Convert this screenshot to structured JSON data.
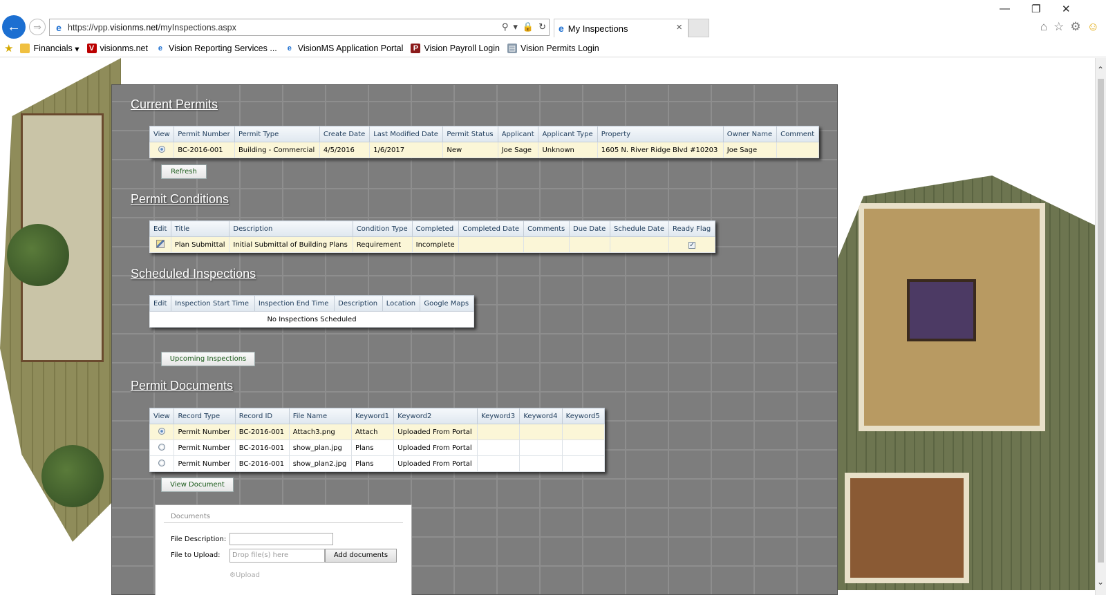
{
  "browser": {
    "url_prefix": "https://vpp.",
    "url_domain": "visionms.net",
    "url_path": "/myInspections.aspx",
    "tab_title": "My Inspections",
    "favorites": [
      {
        "label": "Financials",
        "icon": "folder-icon",
        "has_dropdown": true
      },
      {
        "label": "visionms.net",
        "icon": "vision-logo-icon"
      },
      {
        "label": "Vision Reporting Services ...",
        "icon": "ie-page-icon"
      },
      {
        "label": "VisionMS Application Portal",
        "icon": "ie-page-icon"
      },
      {
        "label": "Vision Payroll Login",
        "icon": "payroll-logo-icon"
      },
      {
        "label": "Vision Permits Login",
        "icon": "permits-page-icon"
      }
    ]
  },
  "current_permits": {
    "title": "Current Permits",
    "columns": [
      "View",
      "Permit Number",
      "Permit Type",
      "Create Date",
      "Last Modified Date",
      "Permit Status",
      "Applicant",
      "Applicant Type",
      "Property",
      "Owner Name",
      "Comment"
    ],
    "rows": [
      {
        "permit_number": "BC-2016-001",
        "permit_type": "Building - Commercial",
        "create_date": "4/5/2016",
        "last_modified": "1/6/2017",
        "status": "New",
        "applicant": "Joe Sage",
        "applicant_type": "Unknown",
        "property": "1605 N. River Ridge Blvd #10203",
        "owner": "Joe Sage",
        "comment": ""
      }
    ],
    "refresh_label": "Refresh"
  },
  "permit_conditions": {
    "title": "Permit Conditions",
    "columns": [
      "Edit",
      "Title",
      "Description",
      "Condition Type",
      "Completed",
      "Completed Date",
      "Comments",
      "Due Date",
      "Schedule Date",
      "Ready Flag"
    ],
    "rows": [
      {
        "title": "Plan Submittal",
        "description": "Initial Submittal of Building Plans",
        "condition_type": "Requirement",
        "completed": "Incomplete",
        "completed_date": "",
        "comments": "",
        "due_date": "",
        "schedule_date": "",
        "ready_flag": true
      }
    ]
  },
  "scheduled_inspections": {
    "title": "Scheduled Inspections",
    "columns": [
      "Edit",
      "Inspection Start Time",
      "Inspection End Time",
      "Description",
      "Location",
      "Google Maps"
    ],
    "empty_text": "No Inspections Scheduled",
    "upcoming_label": "Upcoming Inspections"
  },
  "permit_documents": {
    "title": "Permit Documents",
    "columns": [
      "View",
      "Record Type",
      "Record ID",
      "File Name",
      "Keyword1",
      "Keyword2",
      "Keyword3",
      "Keyword4",
      "Keyword5"
    ],
    "rows": [
      {
        "record_type": "Permit Number",
        "record_id": "BC-2016-001",
        "file_name": "Attach3.png",
        "keyword1": "Attach",
        "keyword2": "Uploaded From Portal"
      },
      {
        "record_type": "Permit Number",
        "record_id": "BC-2016-001",
        "file_name": "show_plan.jpg",
        "keyword1": "Plans",
        "keyword2": "Uploaded From Portal"
      },
      {
        "record_type": "Permit Number",
        "record_id": "BC-2016-001",
        "file_name": "show_plan2.jpg",
        "keyword1": "Plans",
        "keyword2": "Uploaded From Portal"
      }
    ],
    "view_document_label": "View Document"
  },
  "documents_upload": {
    "legend": "Documents",
    "file_description_label": "File Description:",
    "file_to_upload_label": "File to Upload:",
    "drop_placeholder": "Drop file(s) here",
    "add_documents_label": "Add documents",
    "upload_label": "Upload"
  },
  "colors": {
    "panel": "#7d7d7d",
    "selected_row": "#fbf6d7",
    "button_text": "#1a5a1a",
    "ie_blue": "#1c6fd1"
  }
}
